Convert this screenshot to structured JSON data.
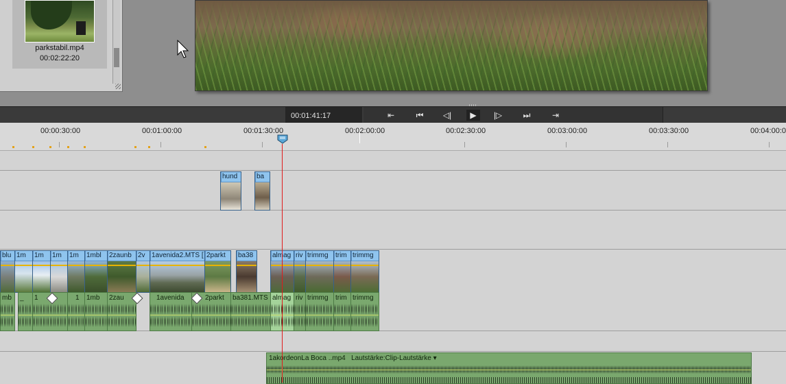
{
  "media_panel": {
    "clip_name": "parkstabil.mp4",
    "clip_duration": "00:02:22:20"
  },
  "transport": {
    "timecode": "00:01:41:17",
    "buttons": [
      {
        "icon": "goto-in-point-icon",
        "glyph": "⇤"
      },
      {
        "icon": "goto-previous-edit-icon",
        "glyph": "⏮"
      },
      {
        "icon": "step-back-icon",
        "glyph": "◁|"
      },
      {
        "icon": "play-icon",
        "glyph": "▶"
      },
      {
        "icon": "step-forward-icon",
        "glyph": "|▷"
      },
      {
        "icon": "goto-next-edit-icon",
        "glyph": "⏭"
      },
      {
        "icon": "goto-out-point-icon",
        "glyph": "⇥"
      }
    ]
  },
  "ruler": {
    "labels": [
      "00:00:30:00",
      "00:01:00:00",
      "00:01:30:00",
      "00:02:00:00",
      "00:02:30:00",
      "00:03:00:00",
      "00:03:30:00",
      "00:04:00:00"
    ]
  },
  "overlay_track": {
    "clips": [
      {
        "label": "hund"
      },
      {
        "label": "ba"
      }
    ]
  },
  "video_track": {
    "clips": [
      {
        "label": "blu"
      },
      {
        "label": "1m"
      },
      {
        "label": "1m"
      },
      {
        "label": "1m"
      },
      {
        "label": "1m"
      },
      {
        "label": "1mbl"
      },
      {
        "label": "2zaunb"
      },
      {
        "label": "2v"
      },
      {
        "label": "1avenida2.MTS ["
      },
      {
        "label": "2parkt"
      },
      {
        "label": "ba38"
      },
      {
        "label": "almag"
      },
      {
        "label": "riv"
      },
      {
        "label": "trimmg"
      },
      {
        "label": "trim"
      },
      {
        "label": "trimmg"
      }
    ]
  },
  "audio_track": {
    "clips": [
      {
        "label": "mb"
      },
      {
        "label": "_"
      },
      {
        "label": "1"
      },
      {
        "label": "1"
      },
      {
        "label": "1mb"
      },
      {
        "label": "2zau"
      },
      {
        "label": "1avenida"
      },
      {
        "label": "2parkt"
      },
      {
        "label": "ba381.MTS"
      },
      {
        "label": "almag"
      },
      {
        "label": "riv"
      },
      {
        "label": "trimmg"
      },
      {
        "label": "trim"
      },
      {
        "label": "trimmg"
      }
    ]
  },
  "music_track": {
    "clip_label": "1akordeonLa Boca ..mp4",
    "volume_label": "Lautstärke:Clip-Lautstärke ▾"
  },
  "colors": {
    "video_clip": "#5f94c7",
    "audio_clip": "#7aa86e",
    "playhead": "#e01b1b",
    "marker": "#e3a21a"
  }
}
